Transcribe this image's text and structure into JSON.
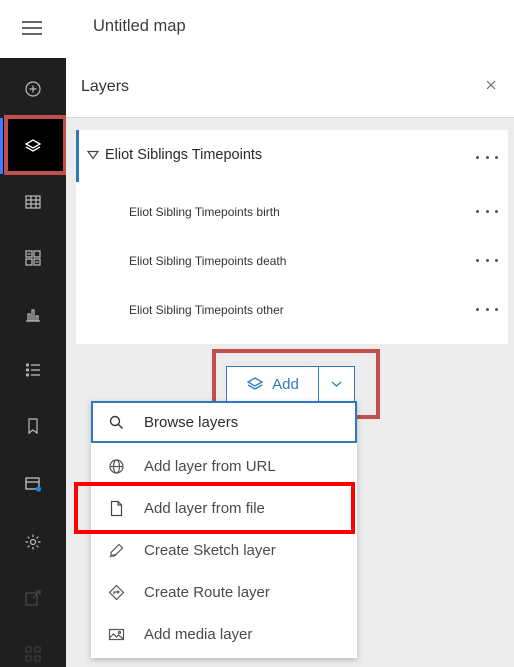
{
  "app": {
    "map_title": "Untitled map"
  },
  "toolbar": {
    "items": [
      {
        "name": "add-data",
        "icon": "plus-circle-icon"
      },
      {
        "name": "layers",
        "icon": "layers-icon",
        "active": true
      },
      {
        "name": "tables",
        "icon": "table-icon"
      },
      {
        "name": "legend",
        "icon": "legend-icon"
      },
      {
        "name": "charts",
        "icon": "chart-icon"
      },
      {
        "name": "list",
        "icon": "list-icon"
      },
      {
        "name": "bookmarks",
        "icon": "bookmark-icon"
      },
      {
        "name": "basemap",
        "icon": "basemap-icon"
      },
      {
        "name": "settings",
        "icon": "gear-icon"
      },
      {
        "name": "share",
        "icon": "share-icon",
        "disabled": true
      },
      {
        "name": "more",
        "icon": "grid-icon",
        "disabled": true
      }
    ]
  },
  "layers_panel": {
    "title": "Layers",
    "group": {
      "label": "Eliot Siblings Timepoints",
      "children": [
        {
          "label": "Eliot Sibling Timepoints birth"
        },
        {
          "label": "Eliot Sibling Timepoints death"
        },
        {
          "label": "Eliot Sibling Timepoints other"
        }
      ]
    }
  },
  "add_button": {
    "label": "Add"
  },
  "add_menu": {
    "items": [
      {
        "label": "Browse layers",
        "icon": "search-icon"
      },
      {
        "label": "Add layer from URL",
        "icon": "globe-icon"
      },
      {
        "label": "Add layer from file",
        "icon": "file-icon"
      },
      {
        "label": "Create Sketch layer",
        "icon": "sketch-icon"
      },
      {
        "label": "Create Route layer",
        "icon": "route-icon"
      },
      {
        "label": "Add media layer",
        "icon": "image-icon"
      }
    ]
  },
  "colors": {
    "accent": "#2f7abf",
    "annotation_box": "#c0504d",
    "highlight_box": "#ff0000",
    "toolbar_bg": "#1f1f1f"
  }
}
